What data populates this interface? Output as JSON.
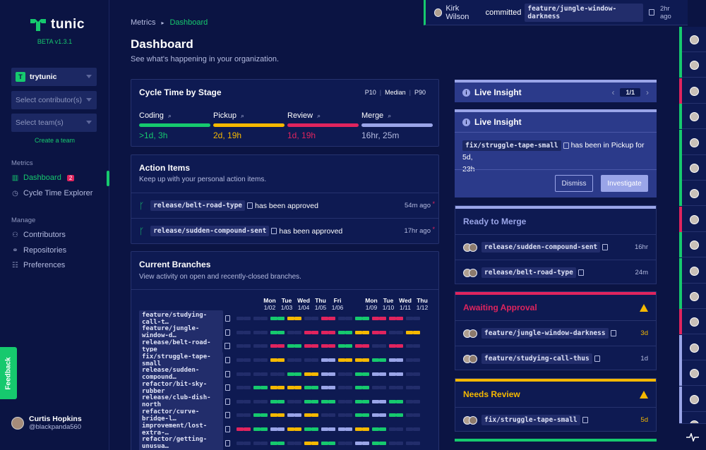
{
  "app": {
    "name": "tunic",
    "version": "BETA v1.3.1",
    "org": "trytunic",
    "contributor_placeholder": "Select contributor(s)",
    "team_placeholder": "Select team(s)",
    "create_team": "Create a team",
    "feedback": "Feedback"
  },
  "nav": {
    "metrics_label": "Metrics",
    "dashboard": "Dashboard",
    "dashboard_badge": "2",
    "cycle_time": "Cycle Time Explorer",
    "manage_label": "Manage",
    "contributors": "Contributors",
    "repositories": "Repositories",
    "preferences": "Preferences"
  },
  "user": {
    "name": "Curtis Hopkins",
    "handle": "@blackpanda560"
  },
  "breadcrumb": {
    "parent": "Metrics",
    "current": "Dashboard"
  },
  "page": {
    "title": "Dashboard",
    "subtitle": "See what's happening in your organization."
  },
  "cycle": {
    "title": "Cycle Time by Stage",
    "p10": "P10",
    "median": "Median",
    "p90": "P90",
    "stages": [
      {
        "name": "Coding",
        "value": ">1d, 3h",
        "color": "#16c96e"
      },
      {
        "name": "Pickup",
        "value": "2d, 19h",
        "color": "#f5b800"
      },
      {
        "name": "Review",
        "value": "1d, 19h",
        "color": "#e0245e"
      },
      {
        "name": "Merge",
        "value": "16hr, 25m",
        "color": "#9aa5e8"
      }
    ]
  },
  "actions": {
    "title": "Action Items",
    "subtitle": "Keep up with your personal action items.",
    "items": [
      {
        "branch": "release/belt-road-type",
        "text": "has been approved",
        "time": "54m ago"
      },
      {
        "branch": "release/sudden-compound-sent",
        "text": "has been approved",
        "time": "17hr ago"
      }
    ]
  },
  "branches": {
    "title": "Current Branches",
    "subtitle": "View activity on open and recently-closed branches.",
    "days": [
      {
        "dow": "Mon",
        "date": "1/02"
      },
      {
        "dow": "Tue",
        "date": "1/03"
      },
      {
        "dow": "Wed",
        "date": "1/04"
      },
      {
        "dow": "Thu",
        "date": "1/05"
      },
      {
        "dow": "Fri",
        "date": "1/06"
      },
      {
        "dow": "Mon",
        "date": "1/09"
      },
      {
        "dow": "Tue",
        "date": "1/10"
      },
      {
        "dow": "Wed",
        "date": "1/11"
      },
      {
        "dow": "Thu",
        "date": "1/12"
      }
    ],
    "rows": [
      {
        "name": "feature/studying-call-t…",
        "segs": "....ggyy..rr..ggrrrr"
      },
      {
        "name": "feature/jungle-window-d…",
        "segs": "....gg..rrrrggyyrr..yyyy"
      },
      {
        "name": "release/belt-road-type",
        "segs": "....rrggrrrrggrr..rr"
      },
      {
        "name": "fix/struggle-tape-small",
        "segs": "....yy....bbyyyyggbb"
      },
      {
        "name": "release/sudden-compound…",
        "segs": "......ggyybb..ggbbbb"
      },
      {
        "name": "refactor/bit-sky-rubber",
        "segs": "..ggyyyyggbb..gg.."
      },
      {
        "name": "release/club-dish-north",
        "segs": "....gg..gggg..ggbbgg"
      },
      {
        "name": "refactor/curve-bridge-l…",
        "segs": "..ggyybbyy....ggbbgg"
      },
      {
        "name": "improvement/lost-extra-…",
        "segs": "rrggbbyyggbbbbyygg"
      },
      {
        "name": "refactor/getting-unusua…",
        "segs": "....gg..yygg..bbgg"
      }
    ]
  },
  "insight_nav": {
    "title": "Live Insight",
    "page": "1/1"
  },
  "insight": {
    "title": "Live Insight",
    "branch": "fix/struggle-tape-small",
    "text1": "has been in Pickup for 5d,",
    "text2": "23h",
    "dismiss": "Dismiss",
    "investigate": "Investigate"
  },
  "ready": {
    "title": "Ready to Merge",
    "items": [
      {
        "branch": "release/sudden-compound-sent",
        "time": "16hr"
      },
      {
        "branch": "release/belt-road-type",
        "time": "24m"
      }
    ]
  },
  "awaiting": {
    "title": "Awaiting Approval",
    "items": [
      {
        "branch": "feature/jungle-window-darkness",
        "time": "3d"
      },
      {
        "branch": "feature/studying-call-thus",
        "time": "1d"
      }
    ]
  },
  "needs": {
    "title": "Needs Review",
    "items": [
      {
        "branch": "fix/struggle-tape-small",
        "time": "5d"
      }
    ]
  },
  "notification": {
    "user": "Kirk Wilson",
    "action": "committed",
    "branch": "feature/jungle-window-darkness",
    "time": "2hr ago"
  },
  "colors": {
    "green": "#16c96e",
    "yellow": "#f5b800",
    "red": "#e0245e",
    "lavender": "#9aa5e8",
    "olive": "#8a7a45",
    "bg": "#0b1443"
  }
}
